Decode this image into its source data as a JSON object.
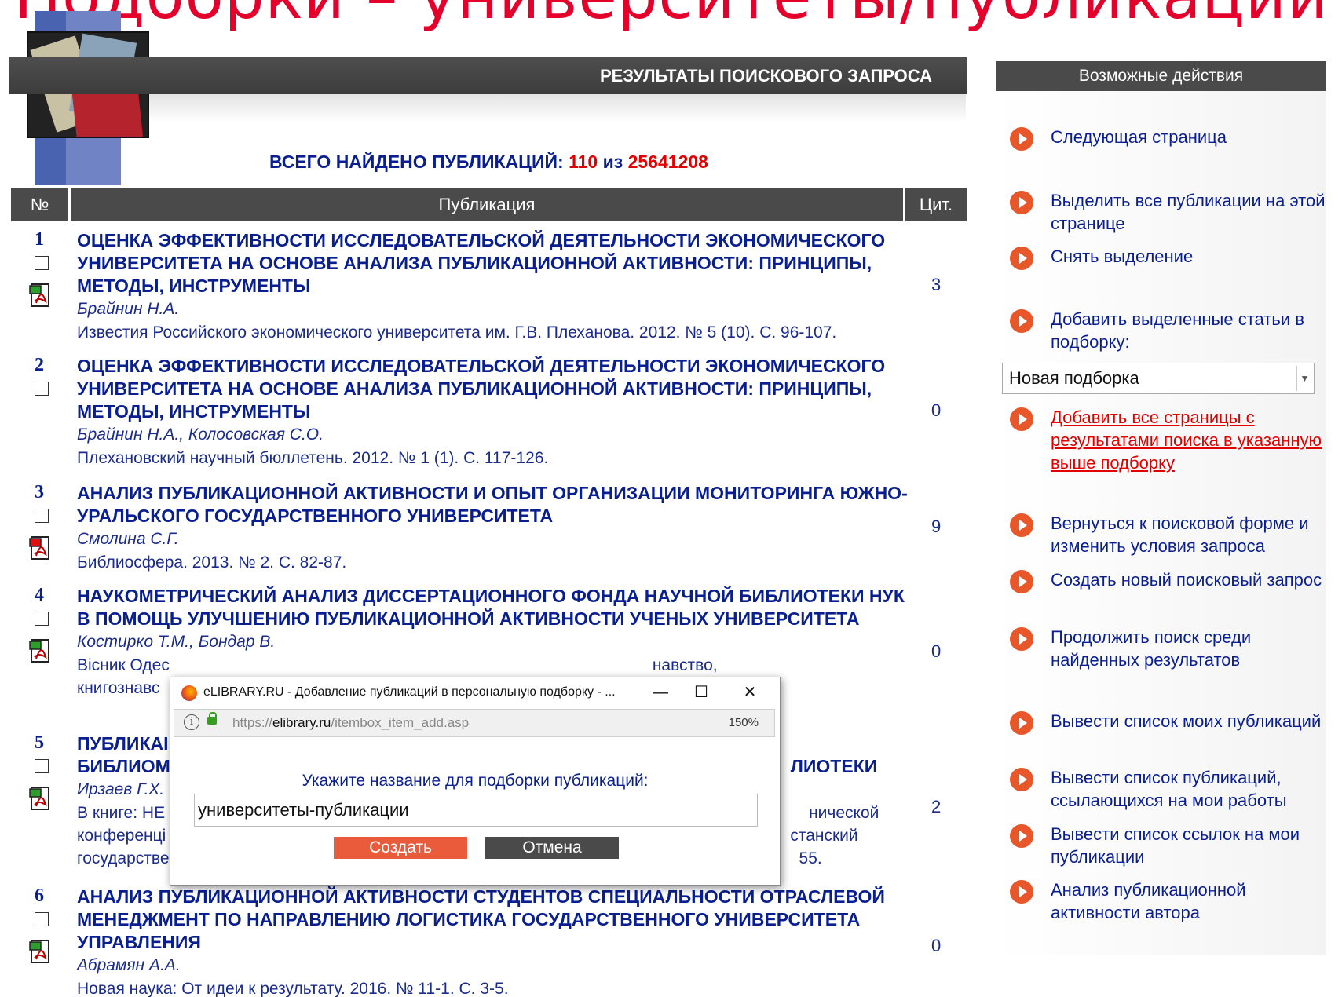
{
  "slide_title": "Подборки – университеты/публикации",
  "header": {
    "results_title": "РЕЗУЛЬТАТЫ ПОИСКОВОГО ЗАПРОСА",
    "actions_title": "Возможные действия"
  },
  "total": {
    "label": "ВСЕГО НАЙДЕНО ПУБЛИКАЦИЙ:",
    "found": "110",
    "of": "из",
    "total": "25641208"
  },
  "table": {
    "col_num": "№",
    "col_pub": "Публикация",
    "col_cit": "Цит."
  },
  "rows": [
    {
      "num": "1",
      "title": "ОЦЕНКА ЭФФЕКТИВНОСТИ ИССЛЕДОВАТЕЛЬСКОЙ ДЕЯТЕЛЬНОСТИ ЭКОНОМИЧЕСКОГО УНИВЕРСИТЕТА НА ОСНОВЕ АНАЛИЗА ПУБЛИКАЦИОННОЙ АКТИВНОСТИ: ПРИНЦИПЫ, МЕТОДЫ, ИНСТРУМЕНТЫ",
      "authors": "Брайнин Н.А.",
      "source": "Известия Российского экономического университета им. Г.В. Плеханова. 2012. № 5 (10). С. 96-107.",
      "cit": "3",
      "pdf": "green"
    },
    {
      "num": "2",
      "title": "ОЦЕНКА ЭФФЕКТИВНОСТИ ИССЛЕДОВАТЕЛЬСКОЙ ДЕЯТЕЛЬНОСТИ ЭКОНОМИЧЕСКОГО УНИВЕРСИТЕТА НА ОСНОВЕ АНАЛИЗА ПУБЛИКАЦИОННОЙ АКТИВНОСТИ: ПРИНЦИПЫ, МЕТОДЫ, ИНСТРУМЕНТЫ",
      "authors": "Брайнин Н.А., Колосовская С.О.",
      "source": "Плехановский научный бюллетень. 2012. № 1 (1). С. 117-126.",
      "cit": "0",
      "pdf": ""
    },
    {
      "num": "3",
      "title": "АНАЛИЗ ПУБЛИКАЦИОННОЙ АКТИВНОСТИ И ОПЫТ ОРГАНИЗАЦИИ МОНИТОРИНГА ЮЖНО-УРАЛЬСКОГО ГОСУДАРСТВЕННОГО УНИВЕРСИТЕТА",
      "authors": "Смолина С.Г.",
      "source": "Библиосфера. 2013. № 2. С. 82-87.",
      "cit": "9",
      "pdf": "red"
    },
    {
      "num": "4",
      "title": "НАУКОМЕТРИЧЕСКИЙ АНАЛИЗ ДИССЕРТАЦИОННОГО ФОНДА НАУЧНОЙ БИБЛИОТЕКИ НУК В ПОМОЩЬ УЛУЧШЕНИЮ ПУБЛИКАЦИОННОЙ АКТИВНОСТИ УЧЕНЫХ УНИВЕРСИТЕТА",
      "authors": "Костирко Т.М., Бондар В.",
      "source": "Вісник Одес",
      "source_right": "навство,",
      "source_line2": "книгознавс",
      "cit": "0",
      "pdf": "green"
    },
    {
      "num": "5",
      "title_left": "ПУБЛИКАІ",
      "title_left2": "БИБЛИОМ",
      "title_right2": "ЛИОТЕКИ",
      "authors": "Ирзаев Г.Х.",
      "source": "В книге: НЕ",
      "source_right": "нической",
      "source_line2": "конференці",
      "source_line2_right": "станский",
      "source_line3": "государстве",
      "source_line3_right": "55.",
      "cit": "2",
      "pdf": "green"
    },
    {
      "num": "6",
      "title": "АНАЛИЗ ПУБЛИКАЦИОННОЙ АКТИВНОСТИ СТУДЕНТОВ СПЕЦИАЛЬНОСТИ ОТРАСЛЕВОЙ МЕНЕДЖМЕНТ ПО НАПРАВЛЕНИЮ ЛОГИСТИКА ГОСУДАРСТВЕННОГО УНИВЕРСИТЕТА УПРАВЛЕНИЯ",
      "authors": "Абрамян А.А.",
      "source": "Новая наука: От идеи к результату. 2016. № 11-1. С. 3-5.",
      "cit": "0",
      "pdf": "green"
    }
  ],
  "actions": [
    {
      "label": "Следующая страница"
    },
    {
      "label": "Выделить все публикации на этой странице"
    },
    {
      "label": "Снять выделение"
    },
    {
      "label": "Добавить выделенные статьи в подборку:"
    },
    {
      "label": "Добавить все страницы с результатами поиска в указанную выше подборку"
    },
    {
      "label": "Вернуться к поисковой форме и изменить условия запроса"
    },
    {
      "label": "Создать новый поисковый запрос"
    },
    {
      "label": "Продолжить поиск среди найденных результатов"
    },
    {
      "label": "Вывести список моих публикаций"
    },
    {
      "label": "Вывести список публикаций, ссылающихся на мои работы"
    },
    {
      "label": "Вывести список ссылок на мои публикации"
    },
    {
      "label": "Анализ публикационной активности автора"
    }
  ],
  "collection_select": {
    "value": "Новая подборка"
  },
  "dialog": {
    "title": "eLIBRARY.RU - Добавление публикаций в персональную подборку - ...",
    "url_prefix": "https://",
    "url_domain": "elibrary.ru",
    "url_path": "/itembox_item_add.asp",
    "zoom": "150%",
    "prompt": "Укажите название для подборки публикаций:",
    "input_value": "университеты-публикации",
    "create_label": "Создать",
    "cancel_label": "Отмена",
    "minimize": "—",
    "maximize": "☐",
    "close": "✕"
  },
  "colors": {
    "accent_red": "#e10000",
    "link_blue": "#0a1f8f",
    "bar_gray": "#4a4a4a",
    "action_orange": "#e8572a"
  }
}
